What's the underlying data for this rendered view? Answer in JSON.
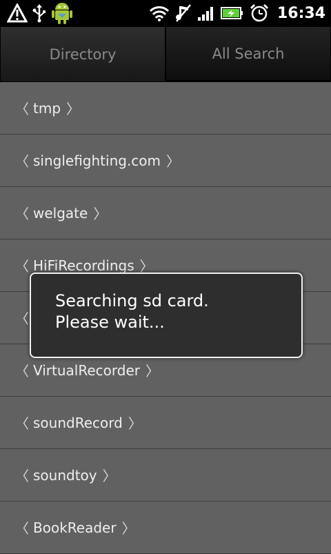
{
  "status_bar": {
    "time": "16:34",
    "left_icons": [
      "warning-icon",
      "usb-icon",
      "android-icon"
    ],
    "right_icons": [
      "wifi-icon",
      "no-sound-icon",
      "signal-icon",
      "battery-charging-icon",
      "alarm-icon"
    ]
  },
  "tabs": [
    {
      "label": "Directory"
    },
    {
      "label": "All Search"
    }
  ],
  "list": {
    "items": [
      {
        "name": "tmp"
      },
      {
        "name": "singlefighting.com"
      },
      {
        "name": "welgate"
      },
      {
        "name": "HiFiRecordings"
      },
      {
        "name": ""
      },
      {
        "name": "VirtualRecorder"
      },
      {
        "name": "soundRecord"
      },
      {
        "name": "soundtoy"
      },
      {
        "name": "BookReader"
      }
    ],
    "open_bracket": "〈",
    "close_bracket": "〉"
  },
  "dialog": {
    "line1": "Searching sd card.",
    "line2": "Please wait..."
  }
}
